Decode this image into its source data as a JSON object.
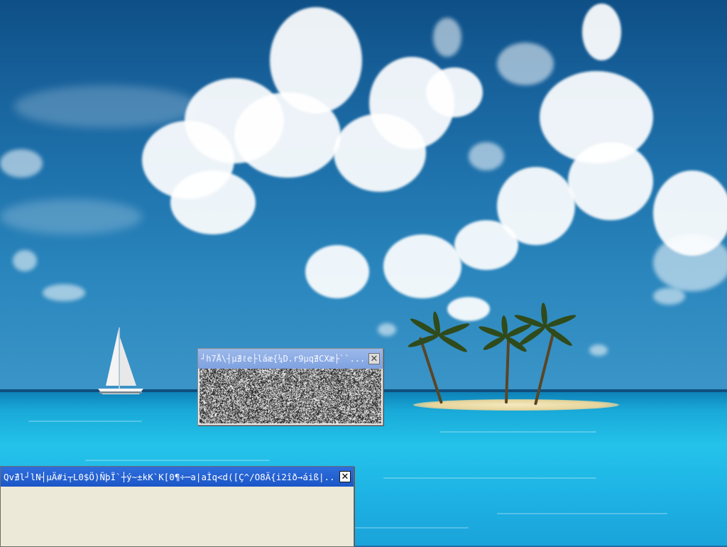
{
  "desktop": {
    "wallpaper": "tropical-island-beach",
    "colors": {
      "sky": "#1f73ad",
      "sea": "#24c3ea",
      "sand": "#f4e9bf"
    }
  },
  "windows": [
    {
      "title": "┘h7Å\\┤µ∄ℓe├láæ{¼D.r9µq∄CXæ├``...",
      "close_icon": "close-icon",
      "content": "random-noise-pattern",
      "titlebar_color": "#8fb0e6"
    },
    {
      "title": "Qv∄l┘lN┤µÄ#i┬L0$Ö)ÑþÏ`┼ý~±kK`K[0¶÷─a|aÌq<d([Ç^/O8Ä{i2îð→áiß|...",
      "close_icon": "close-icon",
      "titlebar_color": "#2563d6"
    }
  ]
}
